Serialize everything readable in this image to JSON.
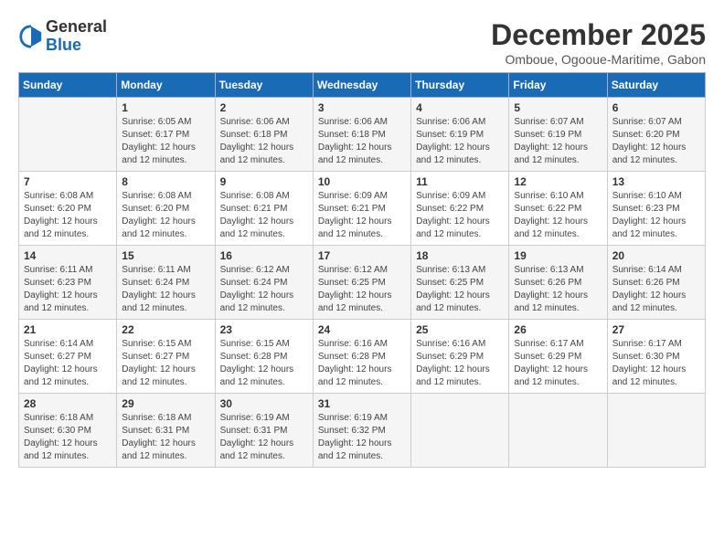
{
  "logo": {
    "general": "General",
    "blue": "Blue"
  },
  "header": {
    "month": "December 2025",
    "location": "Omboue, Ogooue-Maritime, Gabon"
  },
  "weekdays": [
    "Sunday",
    "Monday",
    "Tuesday",
    "Wednesday",
    "Thursday",
    "Friday",
    "Saturday"
  ],
  "weeks": [
    [
      {
        "day": "",
        "sunrise": "",
        "sunset": "",
        "daylight": ""
      },
      {
        "day": "1",
        "sunrise": "Sunrise: 6:05 AM",
        "sunset": "Sunset: 6:17 PM",
        "daylight": "Daylight: 12 hours and 12 minutes."
      },
      {
        "day": "2",
        "sunrise": "Sunrise: 6:06 AM",
        "sunset": "Sunset: 6:18 PM",
        "daylight": "Daylight: 12 hours and 12 minutes."
      },
      {
        "day": "3",
        "sunrise": "Sunrise: 6:06 AM",
        "sunset": "Sunset: 6:18 PM",
        "daylight": "Daylight: 12 hours and 12 minutes."
      },
      {
        "day": "4",
        "sunrise": "Sunrise: 6:06 AM",
        "sunset": "Sunset: 6:19 PM",
        "daylight": "Daylight: 12 hours and 12 minutes."
      },
      {
        "day": "5",
        "sunrise": "Sunrise: 6:07 AM",
        "sunset": "Sunset: 6:19 PM",
        "daylight": "Daylight: 12 hours and 12 minutes."
      },
      {
        "day": "6",
        "sunrise": "Sunrise: 6:07 AM",
        "sunset": "Sunset: 6:20 PM",
        "daylight": "Daylight: 12 hours and 12 minutes."
      }
    ],
    [
      {
        "day": "7",
        "sunrise": "Sunrise: 6:08 AM",
        "sunset": "Sunset: 6:20 PM",
        "daylight": "Daylight: 12 hours and 12 minutes."
      },
      {
        "day": "8",
        "sunrise": "Sunrise: 6:08 AM",
        "sunset": "Sunset: 6:20 PM",
        "daylight": "Daylight: 12 hours and 12 minutes."
      },
      {
        "day": "9",
        "sunrise": "Sunrise: 6:08 AM",
        "sunset": "Sunset: 6:21 PM",
        "daylight": "Daylight: 12 hours and 12 minutes."
      },
      {
        "day": "10",
        "sunrise": "Sunrise: 6:09 AM",
        "sunset": "Sunset: 6:21 PM",
        "daylight": "Daylight: 12 hours and 12 minutes."
      },
      {
        "day": "11",
        "sunrise": "Sunrise: 6:09 AM",
        "sunset": "Sunset: 6:22 PM",
        "daylight": "Daylight: 12 hours and 12 minutes."
      },
      {
        "day": "12",
        "sunrise": "Sunrise: 6:10 AM",
        "sunset": "Sunset: 6:22 PM",
        "daylight": "Daylight: 12 hours and 12 minutes."
      },
      {
        "day": "13",
        "sunrise": "Sunrise: 6:10 AM",
        "sunset": "Sunset: 6:23 PM",
        "daylight": "Daylight: 12 hours and 12 minutes."
      }
    ],
    [
      {
        "day": "14",
        "sunrise": "Sunrise: 6:11 AM",
        "sunset": "Sunset: 6:23 PM",
        "daylight": "Daylight: 12 hours and 12 minutes."
      },
      {
        "day": "15",
        "sunrise": "Sunrise: 6:11 AM",
        "sunset": "Sunset: 6:24 PM",
        "daylight": "Daylight: 12 hours and 12 minutes."
      },
      {
        "day": "16",
        "sunrise": "Sunrise: 6:12 AM",
        "sunset": "Sunset: 6:24 PM",
        "daylight": "Daylight: 12 hours and 12 minutes."
      },
      {
        "day": "17",
        "sunrise": "Sunrise: 6:12 AM",
        "sunset": "Sunset: 6:25 PM",
        "daylight": "Daylight: 12 hours and 12 minutes."
      },
      {
        "day": "18",
        "sunrise": "Sunrise: 6:13 AM",
        "sunset": "Sunset: 6:25 PM",
        "daylight": "Daylight: 12 hours and 12 minutes."
      },
      {
        "day": "19",
        "sunrise": "Sunrise: 6:13 AM",
        "sunset": "Sunset: 6:26 PM",
        "daylight": "Daylight: 12 hours and 12 minutes."
      },
      {
        "day": "20",
        "sunrise": "Sunrise: 6:14 AM",
        "sunset": "Sunset: 6:26 PM",
        "daylight": "Daylight: 12 hours and 12 minutes."
      }
    ],
    [
      {
        "day": "21",
        "sunrise": "Sunrise: 6:14 AM",
        "sunset": "Sunset: 6:27 PM",
        "daylight": "Daylight: 12 hours and 12 minutes."
      },
      {
        "day": "22",
        "sunrise": "Sunrise: 6:15 AM",
        "sunset": "Sunset: 6:27 PM",
        "daylight": "Daylight: 12 hours and 12 minutes."
      },
      {
        "day": "23",
        "sunrise": "Sunrise: 6:15 AM",
        "sunset": "Sunset: 6:28 PM",
        "daylight": "Daylight: 12 hours and 12 minutes."
      },
      {
        "day": "24",
        "sunrise": "Sunrise: 6:16 AM",
        "sunset": "Sunset: 6:28 PM",
        "daylight": "Daylight: 12 hours and 12 minutes."
      },
      {
        "day": "25",
        "sunrise": "Sunrise: 6:16 AM",
        "sunset": "Sunset: 6:29 PM",
        "daylight": "Daylight: 12 hours and 12 minutes."
      },
      {
        "day": "26",
        "sunrise": "Sunrise: 6:17 AM",
        "sunset": "Sunset: 6:29 PM",
        "daylight": "Daylight: 12 hours and 12 minutes."
      },
      {
        "day": "27",
        "sunrise": "Sunrise: 6:17 AM",
        "sunset": "Sunset: 6:30 PM",
        "daylight": "Daylight: 12 hours and 12 minutes."
      }
    ],
    [
      {
        "day": "28",
        "sunrise": "Sunrise: 6:18 AM",
        "sunset": "Sunset: 6:30 PM",
        "daylight": "Daylight: 12 hours and 12 minutes."
      },
      {
        "day": "29",
        "sunrise": "Sunrise: 6:18 AM",
        "sunset": "Sunset: 6:31 PM",
        "daylight": "Daylight: 12 hours and 12 minutes."
      },
      {
        "day": "30",
        "sunrise": "Sunrise: 6:19 AM",
        "sunset": "Sunset: 6:31 PM",
        "daylight": "Daylight: 12 hours and 12 minutes."
      },
      {
        "day": "31",
        "sunrise": "Sunrise: 6:19 AM",
        "sunset": "Sunset: 6:32 PM",
        "daylight": "Daylight: 12 hours and 12 minutes."
      },
      {
        "day": "",
        "sunrise": "",
        "sunset": "",
        "daylight": ""
      },
      {
        "day": "",
        "sunrise": "",
        "sunset": "",
        "daylight": ""
      },
      {
        "day": "",
        "sunrise": "",
        "sunset": "",
        "daylight": ""
      }
    ]
  ]
}
